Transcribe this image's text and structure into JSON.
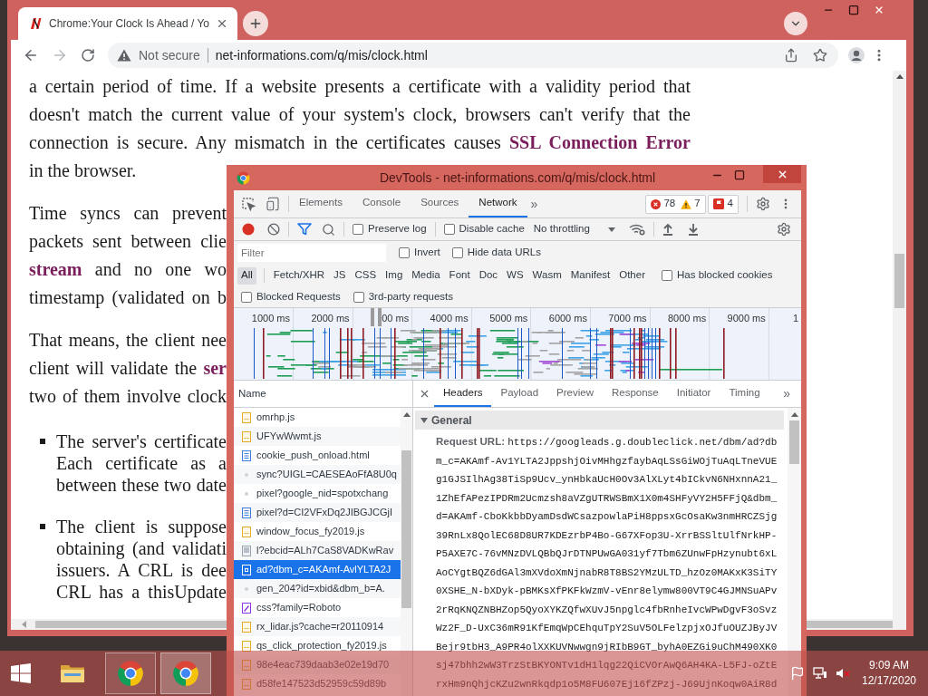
{
  "browser": {
    "tabs": [
      {
        "title": "Chrome:Your Clock Is Ahead / Yo",
        "selected": true
      }
    ],
    "address_bar": {
      "security": "Not secure",
      "url": "net-informations.com/q/mis/clock.html"
    },
    "page": {
      "paragraphs": [
        {
          "kind": "paragraph",
          "lines": [
            "a certain period of time. If a website presents a certificate with a validity period that",
            "doesn't match the current value of your system's clock, browsers can't verify that the",
            "connection is secure. Any mismatch in the certificates causes **SSL Connection Error**",
            "in the browser."
          ]
        },
        {
          "kind": "paragraph",
          "lines": [
            "Time syncs can prevent",
            "packets sent between clie",
            "**stream** and no one wo",
            "timestamp (validated on b"
          ]
        },
        {
          "kind": "paragraph",
          "lines": [
            "That means, the client nee",
            "client will validate the **ser**",
            "two of them involve clock"
          ]
        },
        {
          "kind": "bullet",
          "lines": [
            "The server's certificate",
            "Each certificate as a",
            "between these two date"
          ]
        },
        {
          "kind": "bullet",
          "lines": [
            "The client is suppose",
            "obtaining (and validati",
            "issuers. A CRL is dee",
            "CRL has a thisUpdate"
          ]
        }
      ]
    }
  },
  "devtools": {
    "title": "DevTools - net-informations.com/q/mis/clock.html",
    "panel_tabs": [
      {
        "label": "Elements",
        "selected": false
      },
      {
        "label": "Console",
        "selected": false
      },
      {
        "label": "Sources",
        "selected": false
      },
      {
        "label": "Network",
        "selected": true
      }
    ],
    "more_tabs": "»",
    "issue_counts": {
      "errors": "78",
      "warnings": "7",
      "issues": "4"
    },
    "toolbar": {
      "recording": true,
      "options": [
        {
          "label": "Preserve log",
          "checked": false
        },
        {
          "label": "Disable cache",
          "checked": false
        }
      ],
      "throttling": "No throttling"
    },
    "filter": {
      "placeholder": "Filter",
      "options": [
        {
          "label": "Invert",
          "checked": false
        },
        {
          "label": "Hide data URLs",
          "checked": false
        }
      ]
    },
    "resource_types": [
      {
        "label": "All",
        "selected": true
      },
      {
        "label": "Fetch/XHR",
        "selected": false
      },
      {
        "label": "JS",
        "selected": false
      },
      {
        "label": "CSS",
        "selected": false
      },
      {
        "label": "Img",
        "selected": false
      },
      {
        "label": "Media",
        "selected": false
      },
      {
        "label": "Font",
        "selected": false
      },
      {
        "label": "Doc",
        "selected": false
      },
      {
        "label": "WS",
        "selected": false
      },
      {
        "label": "Wasm",
        "selected": false
      },
      {
        "label": "Manifest",
        "selected": false
      },
      {
        "label": "Other",
        "selected": false
      }
    ],
    "blocked_cookies": {
      "label": "Has blocked cookies",
      "checked": false
    },
    "request_options": [
      {
        "label": "Blocked Requests",
        "checked": false
      },
      {
        "label": "3rd-party requests",
        "checked": false
      }
    ],
    "overview": {
      "ticks": [
        "1000 ms",
        "2000 ms",
        "00 ms",
        "4000 ms",
        "5000 ms",
        "6000 ms",
        "7000 ms",
        "8000 ms",
        "9000 ms",
        "1"
      ]
    },
    "requests": {
      "column": "Name",
      "rows": [
        {
          "name": "omrhp.js",
          "kind": "script",
          "selected": false
        },
        {
          "name": "UFYwWwmt.js",
          "kind": "script",
          "selected": false
        },
        {
          "name": "cookie_push_onload.html",
          "kind": "document",
          "selected": false
        },
        {
          "name": "sync?UIGL=CAESEAoFfA8U0q",
          "kind": "other",
          "selected": false
        },
        {
          "name": "pixel?google_nid=spotxchang",
          "kind": "other",
          "selected": false
        },
        {
          "name": "pixel?d=CI2VFxDq2JIBGJCGjI",
          "kind": "document",
          "selected": false
        },
        {
          "name": "window_focus_fy2019.js",
          "kind": "script",
          "selected": false
        },
        {
          "name": "l?ebcid=ALh7CaS8VADKwRav",
          "kind": "image",
          "selected": false
        },
        {
          "name": "ad?dbm_c=AKAmf-AvlYLTA2J",
          "kind": "frame",
          "selected": true
        },
        {
          "name": "gen_204?id=xbid&dbm_b=A.",
          "kind": "other",
          "selected": false
        },
        {
          "name": "css?family=Roboto",
          "kind": "stylesheet",
          "selected": false
        },
        {
          "name": "rx_lidar.js?cache=r20110914",
          "kind": "script",
          "selected": false
        },
        {
          "name": "qs_click_protection_fy2019.js",
          "kind": "script",
          "selected": false
        },
        {
          "name": "98e4eac739daab3e02e19d70",
          "kind": "script",
          "selected": false
        },
        {
          "name": "d58fe147523d52959c59d89b",
          "kind": "script",
          "selected": false
        }
      ]
    },
    "details": {
      "tabs": [
        {
          "label": "Headers",
          "selected": true
        },
        {
          "label": "Payload",
          "selected": false
        },
        {
          "label": "Preview",
          "selected": false
        },
        {
          "label": "Response",
          "selected": false
        },
        {
          "label": "Initiator",
          "selected": false
        },
        {
          "label": "Timing",
          "selected": false
        }
      ],
      "more_tabs": "»",
      "section": {
        "title": "General",
        "expanded": true
      },
      "request_url": {
        "label": "Request URL:",
        "value": "https://googleads.g.doubleclick.net/dbm/ad?dbm_c=AKAmf-Av1YLTA2JppshjOivMHhgzfaybAqLSsGiWOjTuAqLTneVUEg1GJSIlhAg38TiSp9Ucv_ynHbkaUcH0Ov3AlXLyt4bICkvN6NHxnnA21_1ZhEfAPezIPDRm2Ucmzsh8aVZgUTRWSBmX1X0m4SHFyVY2H5FFjQ&dbm_d=AKAmf-CboKkbbDyamDsdWCsazpowlaPiH8ppsxGcOsaKw3nmHRCZSjg39RnLx8QolEC68D8UR7KDEzrbP4Bo-G67XFop3U-XrrBSSltUlfNrkHP-P5AXE7C-76vMNzDVLQBbQJrDTNPUwGA031yf7Tbm6ZUnwFpHzynubt6xLAoCYgtBQZ6dGAl3mXVdoXmNjnabR8T8BS2YMzULTD_hzOz0MAKxK3SiTY0XSHE_N-bXDyk-pBMKsXfPKFkWzmV-vEnr8elymw800VT9C4GJMNSuAPv2rRqKNQZNBHZop5QyoXYKZQfwXUvJ5npglc4fbRnheIvcWPwDgvF3oSvzWz2F_D-UxC36mR91KfEmqWpCEhquTpY2SuV5OLFelzpjxOJfuOUZJByJVBejr9tbH3_A9PR4olXXKUVNwwgn9jRIbB9GT_byhA0EZGi9uChM490XK0sj47bhh2wW3TrzStBKYONTv1dH1lqg22QiCVOrAwQ6AH4KA-L5FJ-oZtErxHm9nQhjcKZu2wnRkqdp1o5M8FU607Ej16fZPzj-J69UjnKoqw0AiR8d"
      }
    }
  },
  "taskbar": {
    "apps": [
      {
        "kind": "folder",
        "running": false,
        "selected": false
      },
      {
        "kind": "browser",
        "running": true,
        "selected": false
      },
      {
        "kind": "browser",
        "running": true,
        "selected": true
      }
    ],
    "time": "9:09 AM",
    "date": "12/17/2020"
  }
}
